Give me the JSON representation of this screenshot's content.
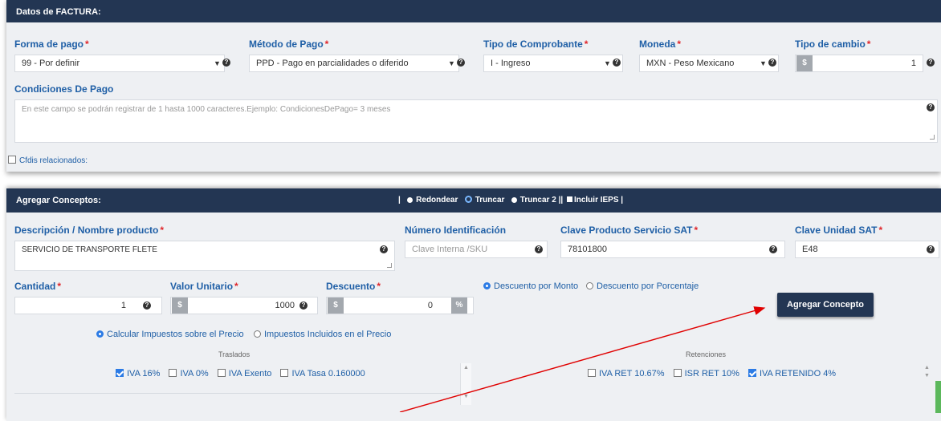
{
  "factura": {
    "header": "Datos de FACTURA:",
    "forma_pago": {
      "label": "Forma de pago",
      "value": "99 - Por definir"
    },
    "metodo_pago": {
      "label": "Método de Pago",
      "value": "PPD - Pago en parcialidades o diferido"
    },
    "tipo_comprobante": {
      "label": "Tipo de Comprobante",
      "value": "I - Ingreso"
    },
    "moneda": {
      "label": "Moneda",
      "value": "MXN - Peso Mexicano"
    },
    "tipo_cambio": {
      "label": "Tipo de cambio",
      "addon": "$",
      "value": "1"
    },
    "condiciones": {
      "label": "Condiciones De Pago",
      "placeholder": "En este campo se podrán registrar de 1 hasta 1000 caracteres.Ejemplo: CondicionesDePago= 3 meses"
    },
    "cfdis_label": "Cfdis relacionados:"
  },
  "conceptos": {
    "header": "Agregar Conceptos:",
    "rounding": {
      "sep1": "|",
      "redondear": "Redondear",
      "truncar": "Truncar",
      "truncar2": "Truncar 2 ||",
      "ieps": "Incluir IEPS |"
    },
    "descripcion": {
      "label": "Descripción / Nombre producto",
      "value": "SERVICIO DE TRANSPORTE FLETE"
    },
    "numero_id": {
      "label": "Número Identificación",
      "placeholder": "Clave Interna /SKU"
    },
    "clave_producto": {
      "label": "Clave Producto Servicio SAT",
      "value": "78101800"
    },
    "clave_unidad": {
      "label": "Clave Unidad SAT",
      "value": "E48"
    },
    "cantidad": {
      "label": "Cantidad",
      "value": "1"
    },
    "valor_unitario": {
      "label": "Valor Unitario",
      "addon": "$",
      "value": "1000"
    },
    "descuento": {
      "label": "Descuento",
      "addon": "$",
      "value": "0",
      "addon_right": "%"
    },
    "desc_monto": "Descuento por Monto",
    "desc_porcentaje": "Descuento por Porcentaje",
    "agregar_btn": "Agregar Concepto",
    "calc_precio": "Calcular Impuestos sobre el Precio",
    "incluidos_precio": "Impuestos Incluidos en el Precio",
    "traslados": {
      "title": "Traslados",
      "items": [
        "IVA 16%",
        "IVA 0%",
        "IVA Exento",
        "IVA Tasa 0.160000"
      ],
      "checked": [
        true,
        false,
        false,
        false
      ]
    },
    "retenciones": {
      "title": "Retenciones",
      "items": [
        "IVA RET 10.67%",
        "ISR RET 10%",
        "IVA RETENIDO 4%"
      ],
      "checked": [
        false,
        false,
        true
      ]
    }
  },
  "colors": {
    "header_bg": "#233653",
    "label_blue": "#1f5fa6",
    "required_red": "#e0262b",
    "annotation_arrow": "#e00000"
  }
}
